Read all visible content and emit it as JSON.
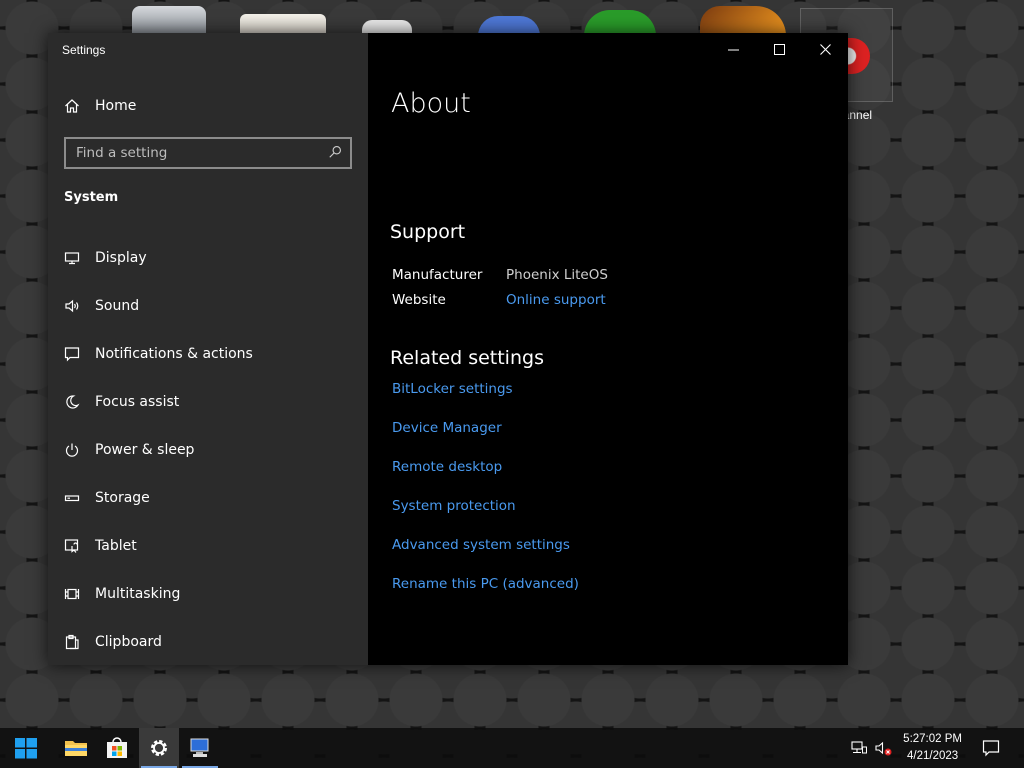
{
  "desktop": {
    "partial_label": "hannel"
  },
  "window": {
    "title": "Settings",
    "controls": {
      "minimize": "minimize",
      "maximize": "maximize",
      "close": "close"
    }
  },
  "sidebar": {
    "home_label": "Home",
    "search_placeholder": "Find a setting",
    "section_title": "System",
    "items": [
      {
        "label": "Display",
        "icon": "monitor-icon"
      },
      {
        "label": "Sound",
        "icon": "speaker-icon"
      },
      {
        "label": "Notifications & actions",
        "icon": "notification-icon"
      },
      {
        "label": "Focus assist",
        "icon": "moon-icon"
      },
      {
        "label": "Power & sleep",
        "icon": "power-icon"
      },
      {
        "label": "Storage",
        "icon": "storage-icon"
      },
      {
        "label": "Tablet",
        "icon": "tablet-icon"
      },
      {
        "label": "Multitasking",
        "icon": "multitasking-icon"
      },
      {
        "label": "Clipboard",
        "icon": "clipboard-icon"
      }
    ]
  },
  "main": {
    "title": "About",
    "support": {
      "heading": "Support",
      "manufacturer_label": "Manufacturer",
      "manufacturer_value": "Phoenix LiteOS",
      "website_label": "Website",
      "website_value": "Online support"
    },
    "related": {
      "heading": "Related settings",
      "links": [
        "BitLocker settings",
        "Device Manager",
        "Remote desktop",
        "System protection",
        "Advanced system settings",
        "Rename this PC (advanced)"
      ]
    }
  },
  "taskbar": {
    "time": "5:27:02 PM",
    "date": "4/21/2023"
  },
  "colors": {
    "accent_link": "#4a9aef",
    "sidebar_bg": "#2b2b2b",
    "main_bg": "#000000"
  }
}
